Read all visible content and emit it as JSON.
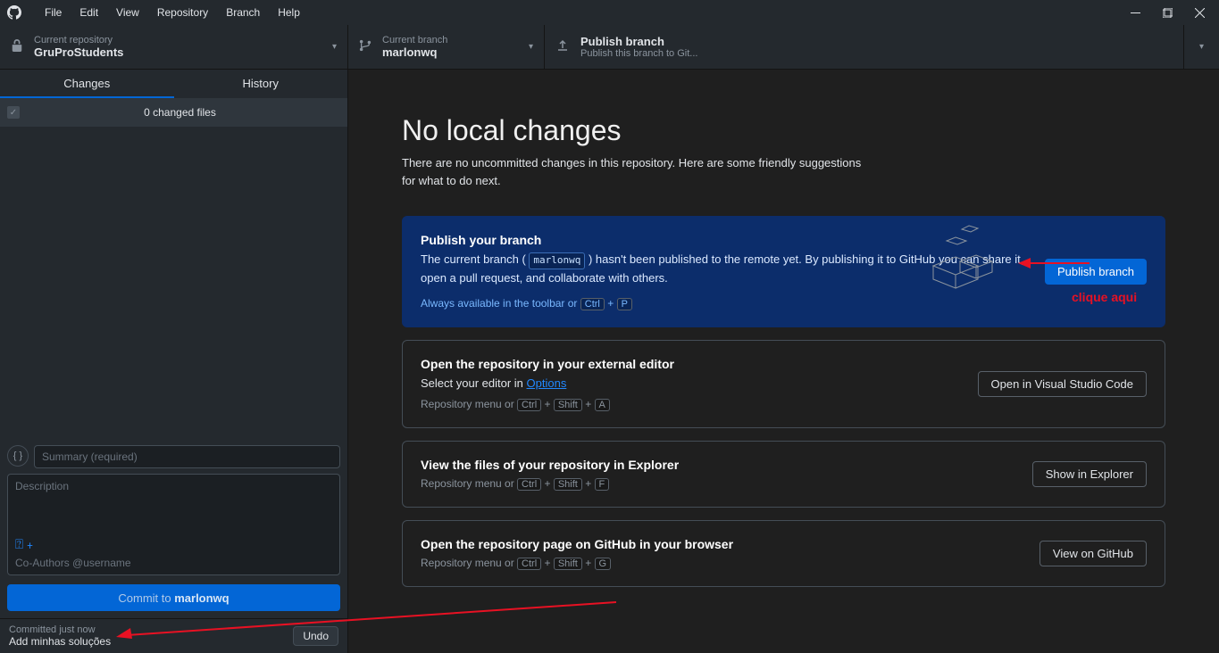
{
  "menubar": [
    "File",
    "Edit",
    "View",
    "Repository",
    "Branch",
    "Help"
  ],
  "toolbar": {
    "repo_label": "Current repository",
    "repo_name": "GruProStudents",
    "branch_label": "Current branch",
    "branch_name": "marlonwq",
    "publish_title": "Publish branch",
    "publish_sub": "Publish this branch to Git..."
  },
  "sidebar": {
    "tabs": {
      "changes": "Changes",
      "history": "History"
    },
    "changed_files": "0 changed files",
    "summary_placeholder": "Summary (required)",
    "description_placeholder": "Description",
    "coauthors_text": "Co-Authors  @username",
    "commit_prefix": "Commit to ",
    "commit_branch": "marlonwq",
    "committed_line1": "Committed just now",
    "committed_line2": "Add minhas soluções",
    "undo": "Undo"
  },
  "content": {
    "headline": "No local changes",
    "subhead": "There are no uncommitted changes in this repository. Here are some friendly suggestions for what to do next.",
    "card1": {
      "title": "Publish your branch",
      "desc_a": "The current branch ( ",
      "branch": "marlonwq",
      "desc_b": " ) hasn't been published to the remote yet. By publishing it to GitHub you can share it, open a pull request, and collaborate with others.",
      "hint_prefix": "Always available in the toolbar or ",
      "k1": "Ctrl",
      "k2": "P",
      "button": "Publish branch"
    },
    "card2": {
      "title": "Open the repository in your external editor",
      "desc_a": "Select your editor in ",
      "link": "Options",
      "hint_prefix": "Repository menu or ",
      "k1": "Ctrl",
      "k2": "Shift",
      "k3": "A",
      "button": "Open in Visual Studio Code"
    },
    "card3": {
      "title": "View the files of your repository in Explorer",
      "hint_prefix": "Repository menu or ",
      "k1": "Ctrl",
      "k2": "Shift",
      "k3": "F",
      "button": "Show in Explorer"
    },
    "card4": {
      "title": "Open the repository page on GitHub in your browser",
      "hint_prefix": "Repository menu or ",
      "k1": "Ctrl",
      "k2": "Shift",
      "k3": "G",
      "button": "View on GitHub"
    }
  },
  "annotation": {
    "text": "clique aqui"
  }
}
